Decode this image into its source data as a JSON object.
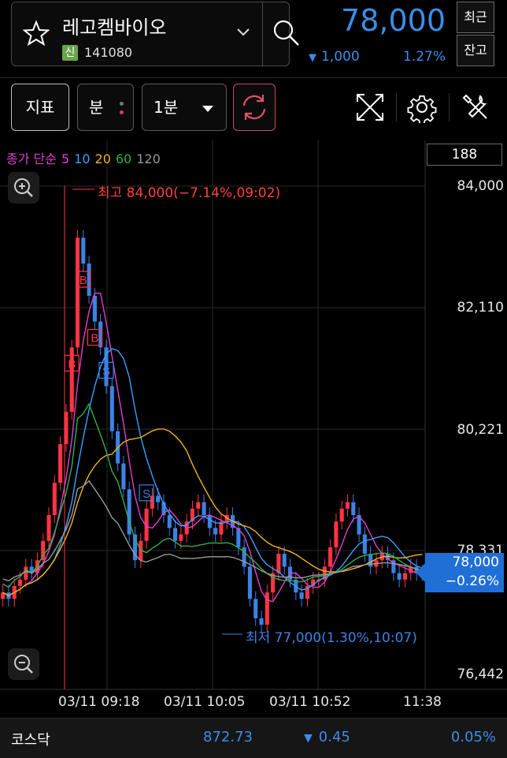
{
  "header": {
    "stock_name": "레고켐바이오",
    "new_tag": "신",
    "stock_code": "141080",
    "price": "78,000",
    "change": "1,000",
    "change_pct": "1.27%",
    "recent_btn": "최근",
    "balance_btn": "잔고"
  },
  "toolbar": {
    "indicator_btn": "지표",
    "minute_btn": "분",
    "interval_select": "1분"
  },
  "legend": {
    "label": "종가 단순",
    "periods": [
      {
        "text": "5",
        "color": "#e040d0"
      },
      {
        "text": "10",
        "color": "#3aa0ff"
      },
      {
        "text": "20",
        "color": "#f2b21c"
      },
      {
        "text": "60",
        "color": "#2fb04a"
      },
      {
        "text": "120",
        "color": "#9a9a9a"
      }
    ]
  },
  "volume_box": "188",
  "chart_data": {
    "type": "candlestick",
    "y_ticks": [
      "84,000",
      "82,110",
      "80,221",
      "78,331",
      "76,442"
    ],
    "x_ticks": [
      "03/11 09:18",
      "03/11 10:05",
      "03/11 10:52",
      "11:38"
    ],
    "ylim": [
      76442,
      84000
    ],
    "high_label": "최고 84,000(−7.14%,09:02)",
    "low_label": "최저 77,000(1.30%,10:07)",
    "current_price": "78,000",
    "current_pct": "−0.26%",
    "markers": [
      "B",
      "B",
      "B",
      "S",
      "S"
    ],
    "close_series": [
      77700,
      77600,
      77800,
      77900,
      78100,
      78000,
      78200,
      78500,
      78900,
      79400,
      80000,
      80500,
      81500,
      83200,
      82800,
      82300,
      81900,
      81500,
      80900,
      80200,
      79700,
      79300,
      78600,
      78200,
      78500,
      79000,
      79200,
      79100,
      78900,
      78700,
      78500,
      78600,
      78800,
      79000,
      79100,
      78900,
      78700,
      78600,
      78800,
      78900,
      78700,
      78400,
      78100,
      77600,
      77300,
      77200,
      77700,
      78000,
      78300,
      78100,
      77900,
      77700,
      77600,
      77800,
      77900,
      77900,
      78100,
      78400,
      78800,
      79000,
      79100,
      78900,
      78600,
      78300,
      78100,
      78200,
      78300,
      78200,
      78000,
      77900,
      78000,
      78100,
      78000,
      78000
    ],
    "ma_colors": {
      "ma5": "#e040d0",
      "ma10": "#3aa0ff",
      "ma20": "#f2b21c",
      "ma60": "#2fb04a",
      "ma120": "#9a9a9a"
    },
    "up_color": "#ff3344",
    "down_color": "#3b82e6"
  },
  "footer": {
    "index_name": "코스닥",
    "index_value": "872.73",
    "index_change": "0.45",
    "index_pct": "0.05%"
  }
}
